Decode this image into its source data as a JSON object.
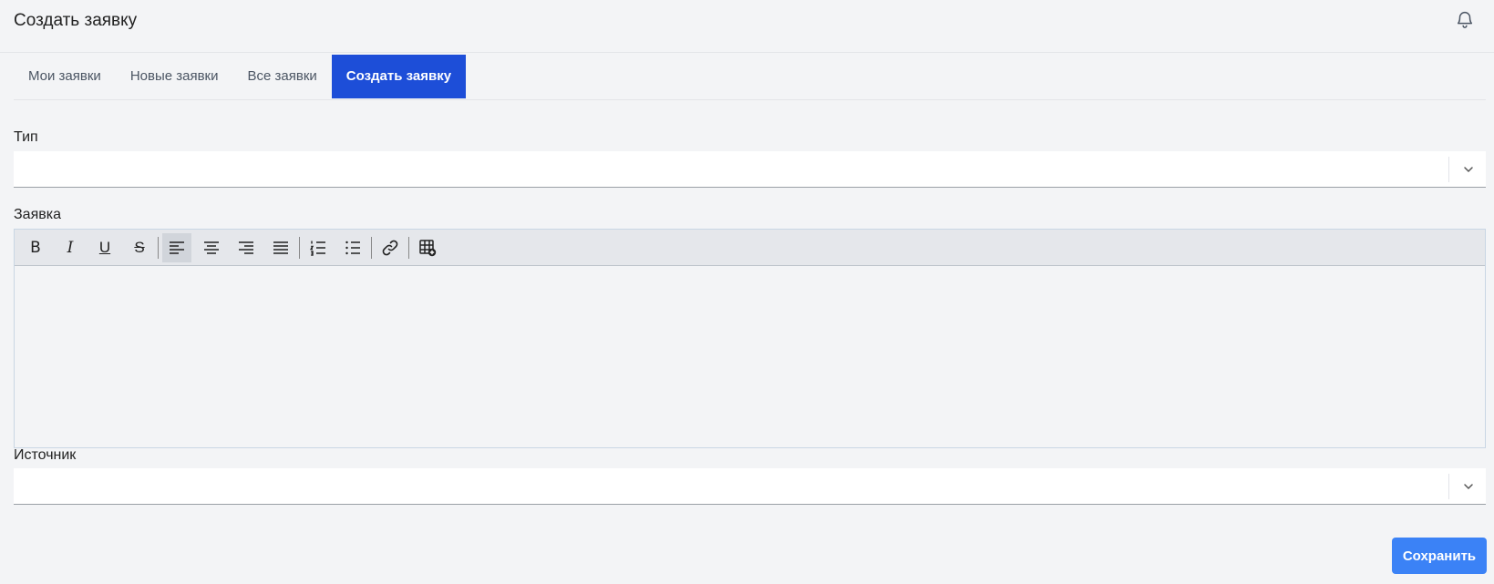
{
  "header": {
    "title": "Создать заявку",
    "bell_icon": "bell-icon"
  },
  "tabs": [
    {
      "label": "Мои заявки",
      "active": false
    },
    {
      "label": "Новые заявки",
      "active": false
    },
    {
      "label": "Все заявки",
      "active": false
    },
    {
      "label": "Создать заявку",
      "active": true
    }
  ],
  "form": {
    "type_label": "Тип",
    "type_value": "",
    "request_label": "Заявка",
    "request_value": "",
    "source_label": "Источник",
    "source_value": "",
    "save_label": "Сохранить"
  },
  "toolbar": {
    "bold": "B",
    "italic": "I",
    "underline": "U",
    "strike": "S",
    "icons": [
      "bold-icon",
      "italic-icon",
      "underline-icon",
      "strikethrough-icon",
      "align-left-icon",
      "align-center-icon",
      "align-right-icon",
      "align-justify-icon",
      "ordered-list-icon",
      "bullet-list-icon",
      "link-icon",
      "insert-table-icon"
    ]
  },
  "colors": {
    "accent": "#1d4ed8",
    "save_button": "#3b82f6",
    "background": "#f3f4f6"
  }
}
